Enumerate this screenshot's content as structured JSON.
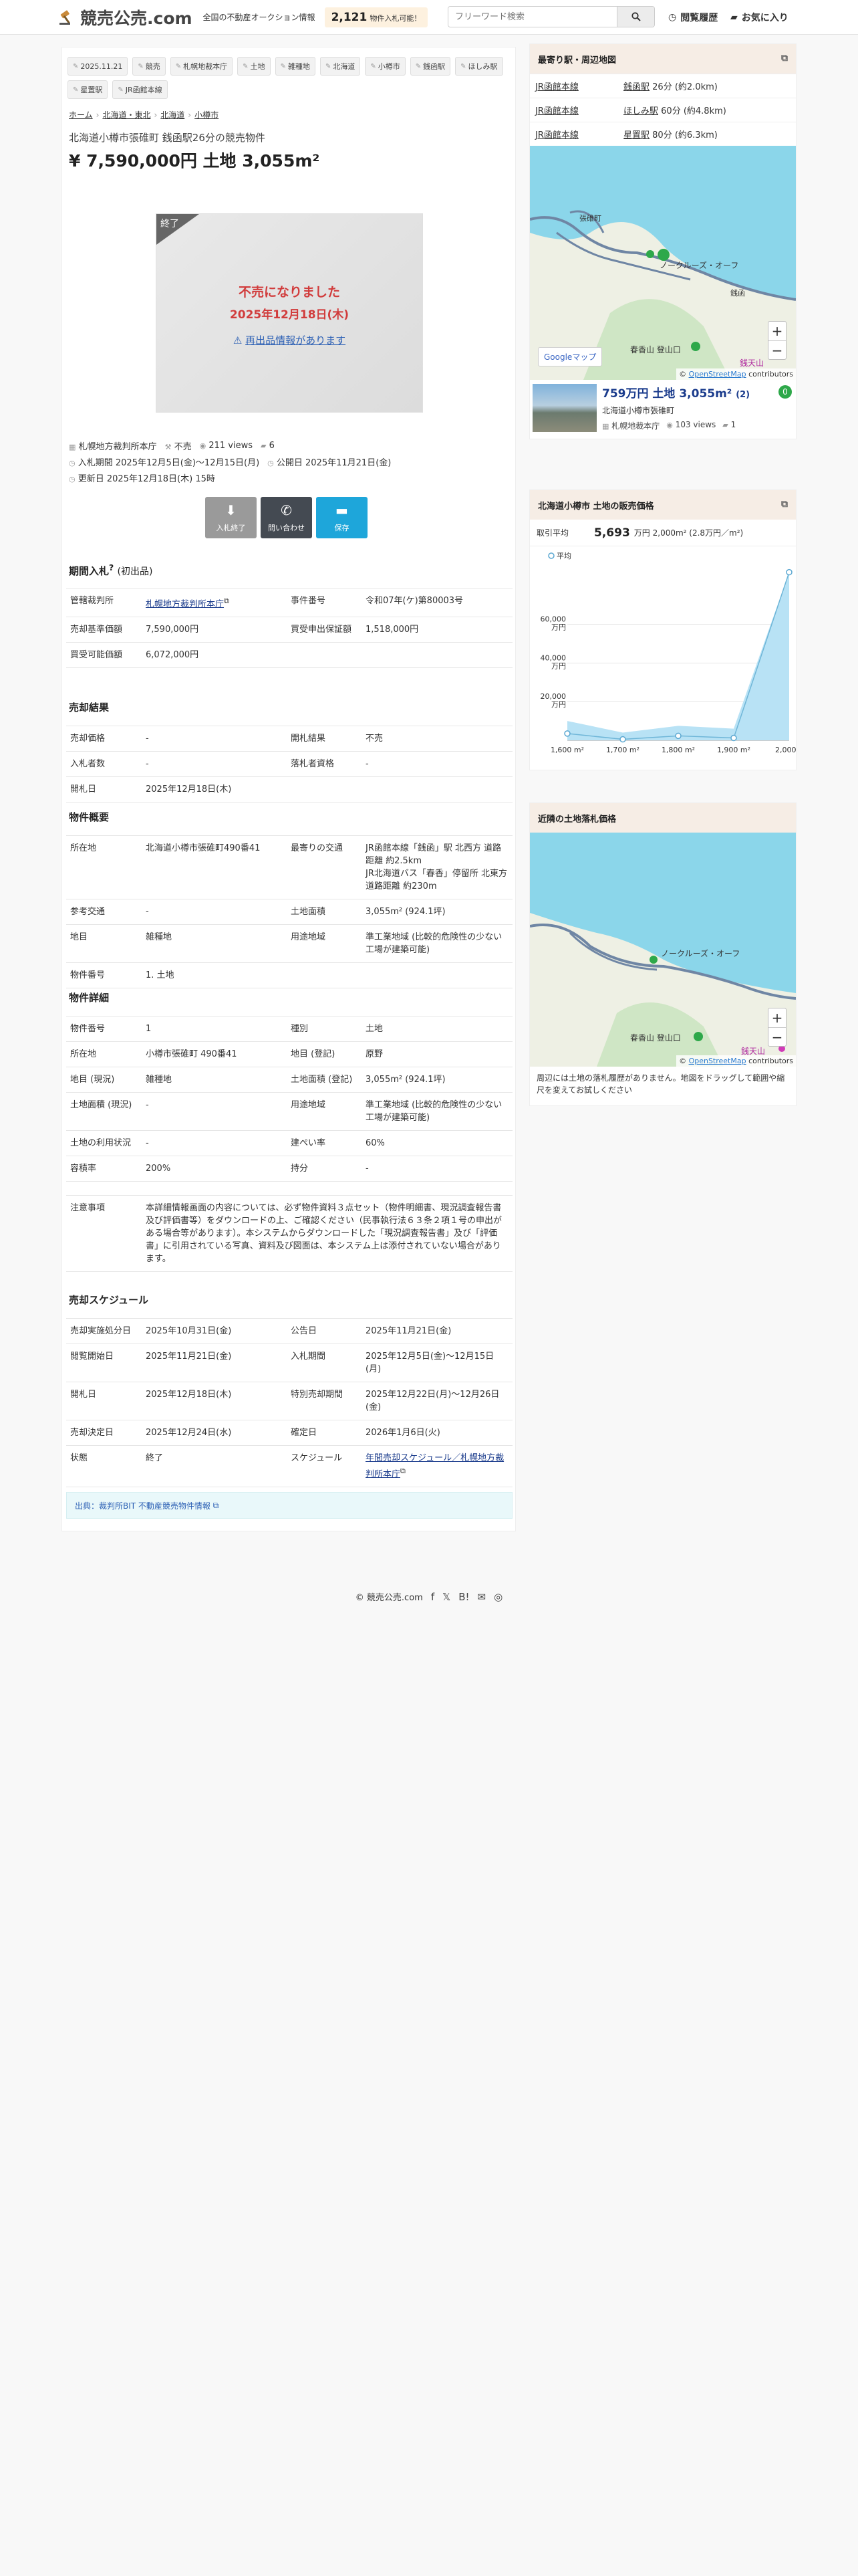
{
  "header": {
    "logo_text": "競売公売.com",
    "tagline": "全国の不動産オークション情報",
    "count": "2,121",
    "count_suffix": "物件入札可能！",
    "search_placeholder": "フリーワード検索",
    "history_label": "閲覧履歴",
    "favorites_label": "お気に入り"
  },
  "tags": [
    "2025.11.21",
    "競売",
    "札幌地裁本庁",
    "土地",
    "雑種地",
    "北海道",
    "小樽市",
    "銭函駅",
    "ほしみ駅",
    "星置駅",
    "JR函館本線"
  ],
  "breadcrumbs": [
    "ホーム",
    "北海道・東北",
    "北海道",
    "小樽市"
  ],
  "property": {
    "subtitle": "北海道小樽市張碓町 銭函駅26分の競売物件",
    "headline": "¥ 7,590,000円 土地 3,055m²",
    "ribbon": "終了",
    "status_text": "不売になりました",
    "status_date": "2025年12月18日(木)",
    "reappear_link": "再出品情報があります"
  },
  "meta": {
    "court": "札幌地方裁判所本庁",
    "result": "不売",
    "views": "211 views",
    "fav_count": "6",
    "bid_period": "入札期間 2025年12月5日(金)〜12月15日(月)",
    "published": "公開日 2025年11月21日(金)",
    "updated": "更新日 2025年12月18日(木) 15時"
  },
  "actions": [
    {
      "label": "入札終了",
      "icon": "⬇",
      "color": "#9a9a9a"
    },
    {
      "label": "問い合わせ",
      "icon": "✆",
      "color": "#444a52"
    },
    {
      "label": "保存",
      "icon": "▬",
      "color": "#1ea6da"
    }
  ],
  "sections": {
    "period": {
      "title": "期間入札",
      "sup": "?",
      "sub": "(初出品)"
    },
    "result": "売却結果",
    "outline": "物件概要",
    "detail": "物件詳細",
    "schedule": "売却スケジュール"
  },
  "period_rows": [
    {
      "k": "管轄裁判所",
      "v": "札幌地方裁判所本庁",
      "link": true,
      "k2": "事件番号",
      "v2": "令和07年(ケ)第80003号"
    },
    {
      "k": "売却基準価額",
      "v": "7,590,000円",
      "k2": "買受申出保証額",
      "v2": "1,518,000円"
    },
    {
      "k": "買受可能価額",
      "v": "6,072,000円",
      "k2": "",
      "v2": ""
    }
  ],
  "result_rows": [
    {
      "k": "売却価格",
      "v": "-",
      "k2": "開札結果",
      "v2": "不売"
    },
    {
      "k": "入札者数",
      "v": "-",
      "k2": "落札者資格",
      "v2": "-"
    },
    {
      "k": "開札日",
      "v": "2025年12月18日(木)",
      "k2": "",
      "v2": ""
    }
  ],
  "outline_rows": [
    {
      "k": "所在地",
      "v": "北海道小樽市張碓町490番41",
      "k2": "最寄りの交通",
      "v2": "JR函館本線「銭函」駅 北西方 道路距離 約2.5km\nJR北海道バス「春香」停留所 北東方 道路距離 約230m"
    },
    {
      "k": "参考交通",
      "v": "-",
      "k2": "土地面積",
      "v2": "3,055m² (924.1坪)"
    },
    {
      "k": "地目",
      "v": "雑種地",
      "k2": "用途地域",
      "v2": "準工業地域 (比較的危険性の少ない工場が建築可能)"
    },
    {
      "k": "物件番号",
      "v": "1. 土地",
      "k2": "",
      "v2": ""
    }
  ],
  "detail_rows": [
    {
      "k": "物件番号",
      "v": "1",
      "k2": "種別",
      "v2": "土地"
    },
    {
      "k": "所在地",
      "v": "小樽市張碓町 490番41",
      "k2": "地目 (登記)",
      "v2": "原野"
    },
    {
      "k": "地目 (現況)",
      "v": "雑種地",
      "k2": "土地面積 (登記)",
      "v2": "3,055m² (924.1坪)"
    },
    {
      "k": "土地面積 (現況)",
      "v": "-",
      "k2": "用途地域",
      "v2": "準工業地域 (比較的危険性の少ない工場が建築可能)"
    },
    {
      "k": "土地の利用状況",
      "v": "-",
      "k2": "建ぺい率",
      "v2": "60%"
    },
    {
      "k": "容積率",
      "v": "200%",
      "k2": "持分",
      "v2": "-"
    }
  ],
  "notice": {
    "k": "注意事項",
    "v": "本詳細情報画面の内容については、必ず物件資料３点セット（物件明細書、現況調査報告書及び評価書等）をダウンロードの上、ご確認ください（民事執行法６３条２項１号の申出がある場合等があります）。本システムからダウンロードした「現況調査報告書」及び「評価書」に引用されている写真、資料及び図面は、本システム上は添付されていない場合があります。"
  },
  "schedule_rows": [
    {
      "k": "売却実施処分日",
      "v": "2025年10月31日(金)",
      "k2": "公告日",
      "v2": "2025年11月21日(金)"
    },
    {
      "k": "閲覧開始日",
      "v": "2025年11月21日(金)",
      "k2": "入札期間",
      "v2": "2025年12月5日(金)〜12月15日(月)"
    },
    {
      "k": "開札日",
      "v": "2025年12月18日(木)",
      "k2": "特別売却期間",
      "v2": "2025年12月22日(月)〜12月26日(金)"
    },
    {
      "k": "売却決定日",
      "v": "2025年12月24日(水)",
      "k2": "確定日",
      "v2": "2026年1月6日(火)"
    },
    {
      "k": "状態",
      "v": "終了",
      "k2": "スケジュール",
      "v2": "年間売却スケジュール／札幌地方裁判所本庁",
      "link2": true
    }
  ],
  "source_text": "出典：裁判所BIT 不動産競売物件情報",
  "nearby": {
    "title": "最寄り駅・周辺地図",
    "stations": [
      {
        "line": "JR函館本線",
        "station": "銭函駅",
        "dist": "26分 (約2.0km)"
      },
      {
        "line": "JR函館本線",
        "station": "ほしみ駅",
        "dist": "60分 (約4.8km)"
      },
      {
        "line": "JR函館本線",
        "station": "星置駅",
        "dist": "80分 (約6.3km)"
      }
    ],
    "map_labels": [
      "張碓町",
      "ノークルーズ・オーフ",
      "銭函",
      "春香山 登山口",
      "銭天山",
      "Googleマップ"
    ],
    "attribution_prefix": "©",
    "attribution_link": "OpenStreetMap",
    "attribution_suffix": "contributors",
    "card": {
      "price": "759万円 土地 3,055m²",
      "count": "(2)",
      "location": "北海道小樽市張碓町",
      "court": "札幌地裁本庁",
      "views": "103 views",
      "favs": "1",
      "badge": "0"
    }
  },
  "price_box": {
    "title": "北海道小樽市 土地の販売価格",
    "avg_label": "取引平均",
    "avg_value": "5,693",
    "avg_unit": "万円",
    "avg_detail": "2,000m² (2.8万円／m²)"
  },
  "chart_data": {
    "type": "area",
    "legend": [
      "平均"
    ],
    "categories": [
      "1,600 m²",
      "1,700 m²",
      "1,800 m²",
      "1,900 m²",
      "2,000..."
    ],
    "series": [
      {
        "name": "平均",
        "values": [
          3500,
          500,
          2300,
          1200,
          87000
        ],
        "upper": [
          10000,
          4000,
          7500,
          6000,
          87000
        ]
      }
    ],
    "yticks": [
      "20,000\n万円",
      "40,000\n万円",
      "60,000\n万円"
    ],
    "ylim": [
      0,
      90000
    ],
    "legend_position": "top-left"
  },
  "map2": {
    "title": "近隣の土地落札価格",
    "note": "周辺には土地の落札履歴がありません。地図をドラッグして範囲や縮尺を変えてお試しください",
    "labels": [
      "ノークルーズ・オーフ",
      "春香山 登山口",
      "銭天山"
    ]
  },
  "footer": {
    "copyright": "© 競売公売.com",
    "icons": [
      "f",
      "𝕏",
      "B!",
      "✉",
      "◎"
    ]
  }
}
